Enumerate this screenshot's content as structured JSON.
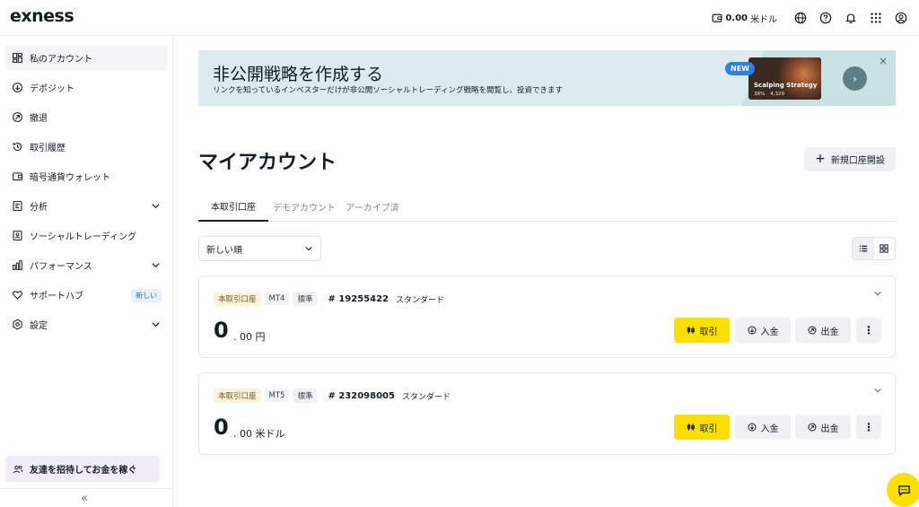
{
  "header": {
    "logo": "exness",
    "balance_amount": "0.00",
    "balance_currency": "米ドル",
    "icons": [
      "wallet-icon",
      "globe-icon",
      "help-icon",
      "bell-icon",
      "apps-grid-icon",
      "profile-icon"
    ]
  },
  "sidebar": {
    "items": [
      {
        "label": "私のアカウント",
        "icon": "dashboard-icon"
      },
      {
        "label": "デポジット",
        "icon": "deposit-icon"
      },
      {
        "label": "撤退",
        "icon": "withdraw-icon"
      },
      {
        "label": "取引履歴",
        "icon": "history-icon"
      },
      {
        "label": "暗号通貨ウォレット",
        "icon": "wallet-icon"
      },
      {
        "label": "分析",
        "icon": "analytics-icon"
      },
      {
        "label": "ソーシャルトレーディング",
        "icon": "social-trading-icon"
      },
      {
        "label": "パフォーマンス",
        "icon": "performance-icon"
      },
      {
        "label": "サポートハブ",
        "icon": "heart-icon"
      },
      {
        "label": "設定",
        "icon": "settings-icon"
      }
    ],
    "support_badge": "新しい",
    "invite_label": "友達を招待してお金を稼ぐ",
    "collapse_symbol": "«"
  },
  "banner": {
    "title": "非公開戦略を作成する",
    "subtitle": "リンクを知っているインベスターだけが非公開ソーシャルトレーディング戦略を閲覧し、投資できます",
    "new_badge": "NEW",
    "card_title": "Scalping Strategy",
    "card_stat1": "38%",
    "card_stat2": "4,329",
    "close_symbol": "×",
    "next_symbol": "›"
  },
  "main": {
    "page_title": "マイアカウント",
    "new_account_button": "新規口座開設",
    "tabs": [
      "本取引口座",
      "デモアカウント",
      "アーカイブ済"
    ],
    "sort_value": "新しい順"
  },
  "accounts": [
    {
      "tags": [
        "本取引口座",
        "MT4",
        "標準"
      ],
      "number": "# 19255422",
      "type": "スタンダード",
      "balance_int": "0",
      "balance_dec": ". 00 円",
      "trade_label": "取引",
      "deposit_label": "入金",
      "withdraw_label": "出金",
      "more_symbol": "⋮"
    },
    {
      "tags": [
        "本取引口座",
        "MT5",
        "標準"
      ],
      "number": "# 232098005",
      "type": "スタンダード",
      "balance_int": "0",
      "balance_dec": ". 00 米ドル",
      "trade_label": "取引",
      "deposit_label": "入金",
      "withdraw_label": "出金",
      "more_symbol": "⋮"
    }
  ],
  "colors": {
    "accent_yellow": "#ffde02",
    "banner_bg": "#dcecee",
    "text_primary": "#141d22",
    "badge_blue": "#2f7fe0"
  }
}
